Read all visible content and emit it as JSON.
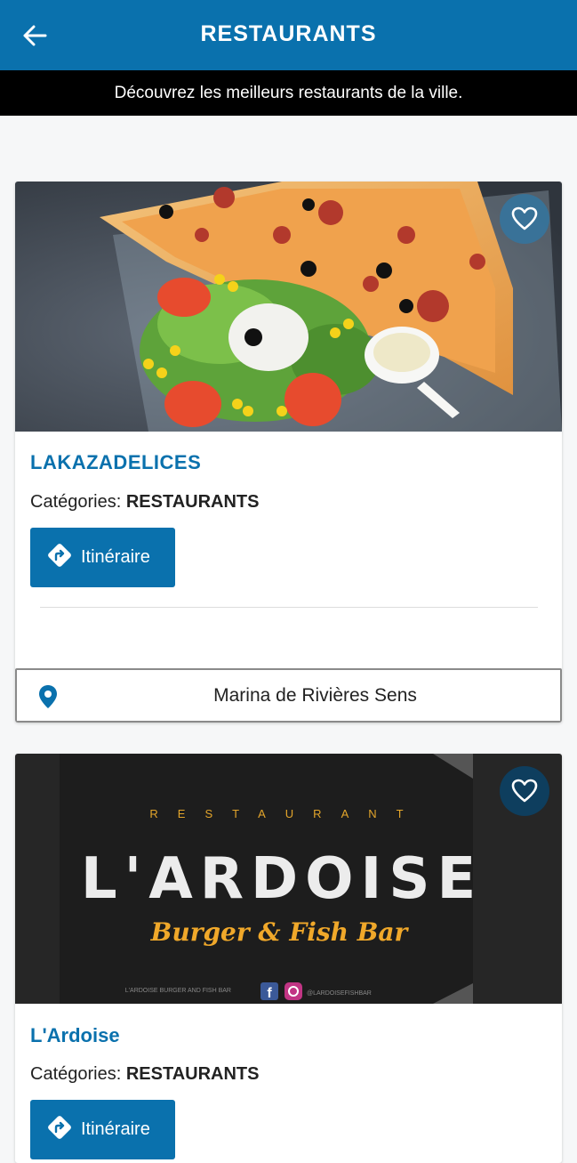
{
  "header": {
    "title": "RESTAURANTS",
    "subtitle": "Découvrez les meilleurs restaurants de la ville."
  },
  "restaurants": [
    {
      "name": "LAKAZADELICES",
      "categories_label": "Catégories:",
      "category": "RESTAURANTS",
      "itinerary_label": "Itinéraire",
      "address": "Marina de Rivières Sens"
    },
    {
      "name": "L'Ardoise",
      "categories_label": "Catégories:",
      "category": "RESTAURANTS",
      "itinerary_label": "Itinéraire",
      "logo": {
        "top": "RESTAURANT",
        "main": "L'ARDOISE",
        "sub": "Burger & Fish Bar",
        "footer_left": "L'ARDOISE BURGER AND FISH BAR",
        "footer_right": "@LARDOISEFISHBAR"
      }
    }
  ],
  "colors": {
    "primary": "#0a71ad",
    "banner": "#000000",
    "background": "#f6f7f8"
  }
}
